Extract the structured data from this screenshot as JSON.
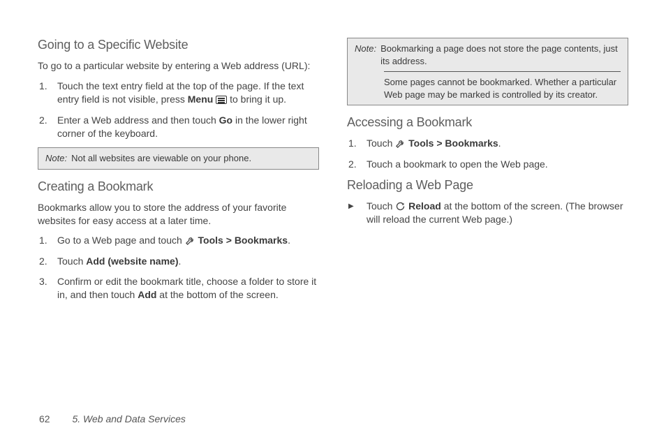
{
  "left": {
    "h_going": "Going to a Specific Website",
    "intro_going": "To go to a particular website by entering a Web address (URL):",
    "going_steps": {
      "s1a": "Touch the text entry field at the top of the page. If the text entry field is not visible, press ",
      "s1_menu": "Menu",
      "s1b": " to bring it up.",
      "s2a": "Enter a Web address and then touch ",
      "s2_go": "Go",
      "s2b": " in the lower right corner of the keyboard."
    },
    "note1_label": "Note:",
    "note1_text": "Not all websites are viewable on your phone.",
    "h_creating": "Creating a Bookmark",
    "intro_creating": "Bookmarks allow you to store the address of your favorite websites for easy access at a later time.",
    "creating_steps": {
      "s1a": "Go to a Web page and touch ",
      "s1_tools": " Tools",
      "s1_gt": " > ",
      "s1_bm": "Bookmarks",
      "s1_dot": ".",
      "s2a": "Touch ",
      "s2_add": "Add (website name)",
      "s2_dot": ".",
      "s3a": "Confirm or edit the bookmark title, choose a folder to store it in, and then touch ",
      "s3_add": "Add",
      "s3b": " at the bottom of the screen."
    }
  },
  "right": {
    "note2_label": "Note:",
    "note2_text": "Bookmarking a page does not store the page contents, just its address.",
    "note2_extra": "Some pages cannot be bookmarked. Whether a particular Web page may be marked is controlled by its creator.",
    "h_access": "Accessing a Bookmark",
    "access_steps": {
      "s1a": "Touch ",
      "s1_tools": " Tools",
      "s1_gt": " > ",
      "s1_bm": "Bookmarks",
      "s1_dot": ".",
      "s2": "Touch a bookmark to open the Web page."
    },
    "h_reload": "Reloading a Web Page",
    "reload": {
      "a": "Touch ",
      "reload": " Reload",
      "b": " at the bottom of the screen. (The browser will reload the current Web page.)"
    }
  },
  "footer": {
    "page": "62",
    "chapter": "5. Web and Data Services"
  }
}
